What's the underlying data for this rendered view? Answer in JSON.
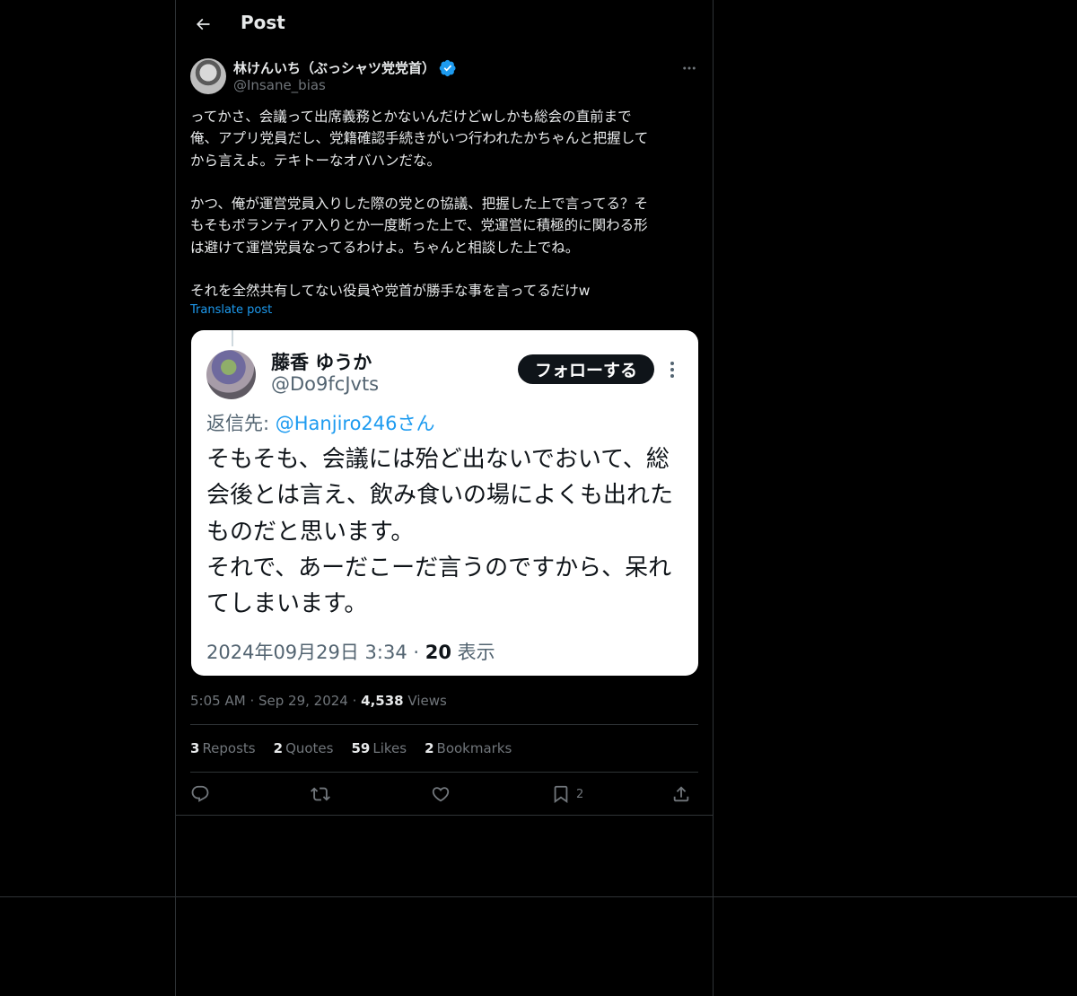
{
  "header": {
    "title": "Post"
  },
  "author": {
    "display_name": "林けんいち（ぶっシャツ党党首）",
    "handle": "@Insane_bias",
    "verified": true
  },
  "post": {
    "text": "ってかさ、会議って出席義務とかないんだけどwしかも総会の直前まで\n俺、アプリ党員だし、党籍確認手続きがいつ行われたかちゃんと把握して\nから言えよ。テキトーなオバハンだな。\n\nかつ、俺が運営党員入りした際の党との協議、把握した上で言ってる？そ\nもそもボランティア入りとか一度断った上で、党運営に積極的に関わる形\nは避けて運営党員なってるわけよ。ちゃんと相談した上でね。\n\nそれを全然共有してない役員や党首が勝手な事を言ってるだけw",
    "translate_label": "Translate post",
    "time": "5:05 AM",
    "date": "Sep 29, 2024",
    "views_count": "4,538",
    "views_label": "Views"
  },
  "embedded": {
    "name": "藤香 ゆうか",
    "handle": "@Do9fcJvts",
    "follow_label": "フォローする",
    "reply_prefix": "返信先: ",
    "reply_mention": "@Hanjiro246さん",
    "text": "そもそも、会議には殆ど出ないでおいて、総\n会後とは言え、飲み食いの場によくも出れた\nものだと思います。\nそれで、あーだこーだ言うのですから、呆れ\nてしまいます。",
    "date": "2024年09月29日 3:34 · ",
    "views_count": "20",
    "views_label": " 表示"
  },
  "stats": {
    "reposts_count": "3",
    "reposts_label": "Reposts",
    "quotes_count": "2",
    "quotes_label": "Quotes",
    "likes_count": "59",
    "likes_label": "Likes",
    "bookmarks_count": "2",
    "bookmarks_label": "Bookmarks"
  },
  "actions": {
    "bookmark_count": "2"
  },
  "colors": {
    "accent": "#1d9bf0",
    "background": "#000000",
    "border": "#2f3336",
    "muted": "#71767b"
  }
}
